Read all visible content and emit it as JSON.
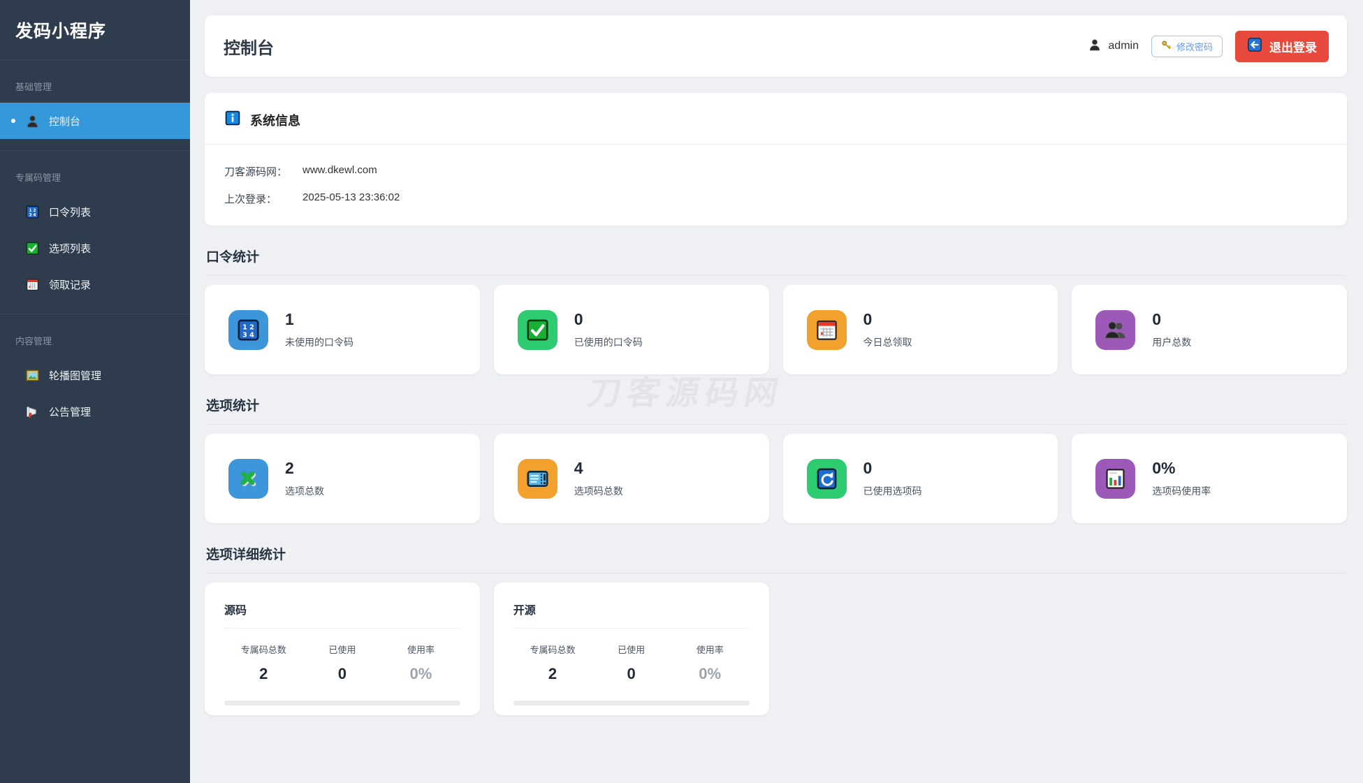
{
  "app": {
    "title": "发码小程序"
  },
  "sidebar": {
    "groups": [
      {
        "label": "基础管理",
        "items": [
          {
            "label": "控制台",
            "icon": "bust-icon",
            "active": true
          }
        ]
      },
      {
        "label": "专属码管理",
        "items": [
          {
            "label": "口令列表",
            "icon": "input-numbers-icon"
          },
          {
            "label": "选项列表",
            "icon": "check-mark-icon"
          },
          {
            "label": "领取记录",
            "icon": "calendar-icon"
          }
        ]
      },
      {
        "label": "内容管理",
        "items": [
          {
            "label": "轮播图管理",
            "icon": "framed-picture-icon"
          },
          {
            "label": "公告管理",
            "icon": "megaphone-icon"
          }
        ]
      }
    ]
  },
  "header": {
    "title": "控制台",
    "username": "admin",
    "change_password": "修改密码",
    "logout": "退出登录"
  },
  "system_info": {
    "title": "系统信息",
    "rows": [
      {
        "label": "刀客源码网：",
        "value": "www.dkewl.com"
      },
      {
        "label": "上次登录：",
        "value": "2025-05-13 23:36:02"
      }
    ]
  },
  "sections": [
    {
      "title": "口令统计",
      "cards": [
        {
          "value": "1",
          "label": "未使用的口令码",
          "icon": "input-numbers-icon",
          "tile_color": "#3d96d9"
        },
        {
          "value": "0",
          "label": "已使用的口令码",
          "icon": "check-mark-icon",
          "tile_color": "#2ecc71"
        },
        {
          "value": "0",
          "label": "今日总领取",
          "icon": "calendar-icon",
          "tile_color": "#f2a12d"
        },
        {
          "value": "0",
          "label": "用户总数",
          "icon": "busts-icon",
          "tile_color": "#9c59b8"
        }
      ]
    },
    {
      "title": "选项统计",
      "cards": [
        {
          "value": "2",
          "label": "选项总数",
          "icon": "cross-mark-icon",
          "tile_color": "#3d96d9"
        },
        {
          "value": "4",
          "label": "选项码总数",
          "icon": "ticket-icon",
          "tile_color": "#f2a12d"
        },
        {
          "value": "0",
          "label": "已使用选项码",
          "icon": "refresh-icon",
          "tile_color": "#2ecc71"
        },
        {
          "value": "0%",
          "label": "选项码使用率",
          "icon": "bar-chart-icon",
          "tile_color": "#9c59b8"
        }
      ]
    }
  ],
  "details": {
    "title": "选项详细统计",
    "cards": [
      {
        "title": "源码",
        "cols": [
          {
            "label": "专属码总数",
            "value": "2"
          },
          {
            "label": "已使用",
            "value": "0"
          },
          {
            "label": "使用率",
            "value": "0%"
          }
        ],
        "progress_percent": 0
      },
      {
        "title": "开源",
        "cols": [
          {
            "label": "专属码总数",
            "value": "2"
          },
          {
            "label": "已使用",
            "value": "0"
          },
          {
            "label": "使用率",
            "value": "0%"
          }
        ],
        "progress_percent": 0
      }
    ]
  },
  "watermark": {
    "text": "刀客源码网"
  },
  "colors": {
    "sidebar_bg": "#2e3c4d",
    "active_item": "#3498db",
    "page_bg": "#eef0f4",
    "logout_red": "#e74a3c",
    "change_pass_blue": "#6d9ae3",
    "watermark_gray": "#e2e4e9"
  }
}
